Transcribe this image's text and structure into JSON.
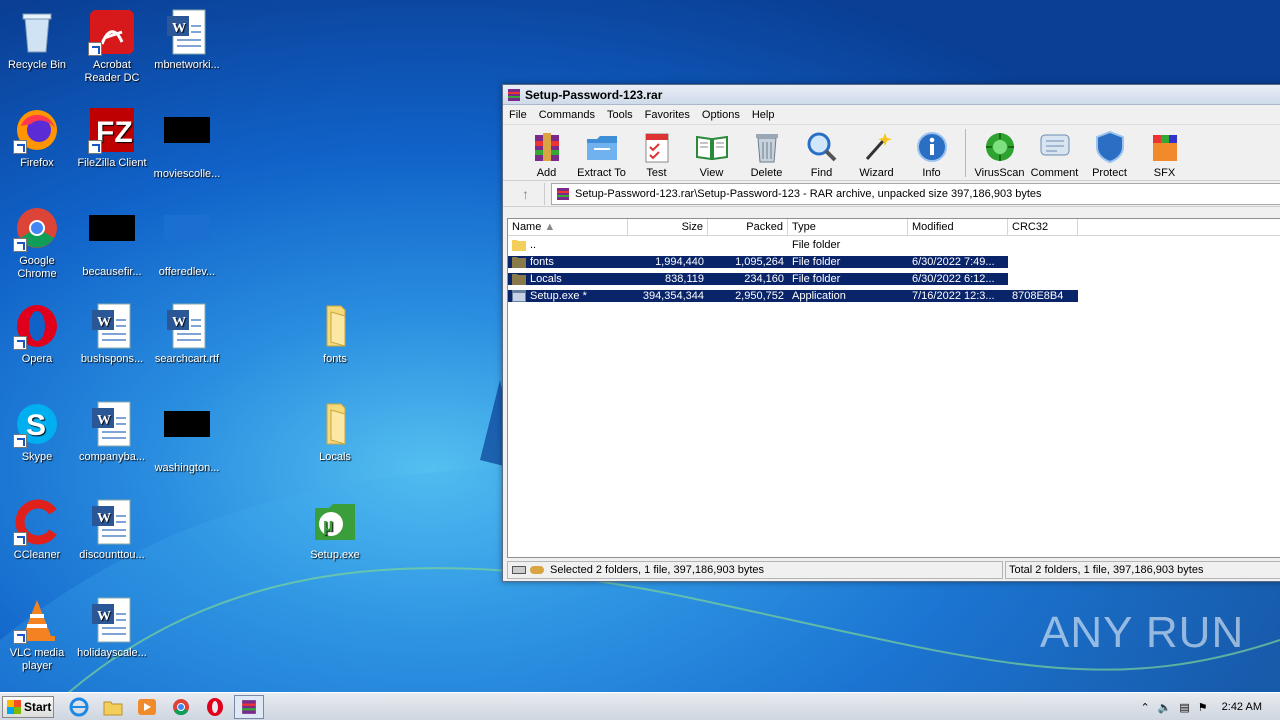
{
  "desktop": {
    "icons": [
      {
        "label": "Recycle Bin"
      },
      {
        "label": "Acrobat Reader DC"
      },
      {
        "label": "mbnetworki..."
      },
      {
        "label": "Firefox"
      },
      {
        "label": "FileZilla Client"
      },
      {
        "label": "moviescolle..."
      },
      {
        "label": "Google Chrome"
      },
      {
        "label": "becausefir..."
      },
      {
        "label": "offeredlev..."
      },
      {
        "label": "Opera"
      },
      {
        "label": "bushspons..."
      },
      {
        "label": "searchcart.rtf"
      },
      {
        "label": "fonts"
      },
      {
        "label": "Skype"
      },
      {
        "label": "companyba..."
      },
      {
        "label": "washington..."
      },
      {
        "label": "Locals"
      },
      {
        "label": "CCleaner"
      },
      {
        "label": "discounttou..."
      },
      {
        "label": "Setup.exe"
      },
      {
        "label": "VLC media player"
      },
      {
        "label": "holidayscale..."
      }
    ]
  },
  "window": {
    "title": "Setup-Password-123.rar",
    "menu": [
      "File",
      "Commands",
      "Tools",
      "Favorites",
      "Options",
      "Help"
    ],
    "toolbar": [
      {
        "label": "Add",
        "icon": "add-icon"
      },
      {
        "label": "Extract To",
        "icon": "extract-icon"
      },
      {
        "label": "Test",
        "icon": "test-icon"
      },
      {
        "label": "View",
        "icon": "view-icon"
      },
      {
        "label": "Delete",
        "icon": "delete-icon"
      },
      {
        "label": "Find",
        "icon": "find-icon"
      },
      {
        "label": "Wizard",
        "icon": "wizard-icon"
      },
      {
        "label": "Info",
        "icon": "info-icon"
      },
      {
        "label": "VirusScan",
        "icon": "virusscan-icon"
      },
      {
        "label": "Comment",
        "icon": "comment-icon"
      },
      {
        "label": "Protect",
        "icon": "protect-icon"
      },
      {
        "label": "SFX",
        "icon": "sfx-icon"
      }
    ],
    "address": "Setup-Password-123.rar\\Setup-Password-123 - RAR archive, unpacked size 397,186,903 bytes",
    "columns": {
      "name": "Name",
      "size": "Size",
      "packed": "Packed",
      "type": "Type",
      "modified": "Modified",
      "crc": "CRC32"
    },
    "rows": [
      {
        "name": "..",
        "size": "",
        "packed": "",
        "type": "File folder",
        "modified": "",
        "crc": "",
        "selected": false
      },
      {
        "name": "fonts",
        "size": "1,994,440",
        "packed": "1,095,264",
        "type": "File folder",
        "modified": "6/30/2022 7:49...",
        "crc": "",
        "selected": true
      },
      {
        "name": "Locals",
        "size": "838,119",
        "packed": "234,160",
        "type": "File folder",
        "modified": "6/30/2022 6:12...",
        "crc": "",
        "selected": true
      },
      {
        "name": "Setup.exe *",
        "size": "394,354,344",
        "packed": "2,950,752",
        "type": "Application",
        "modified": "7/16/2022 12:3...",
        "crc": "8708E8B4",
        "selected": true
      }
    ],
    "status_left": "Selected 2 folders, 1 file, 397,186,903 bytes",
    "status_right": "Total 2 folders, 1 file, 397,186,903 bytes"
  },
  "taskbar": {
    "start_label": "Start",
    "clock": "2:42 AM"
  },
  "watermark": "ANY RUN"
}
